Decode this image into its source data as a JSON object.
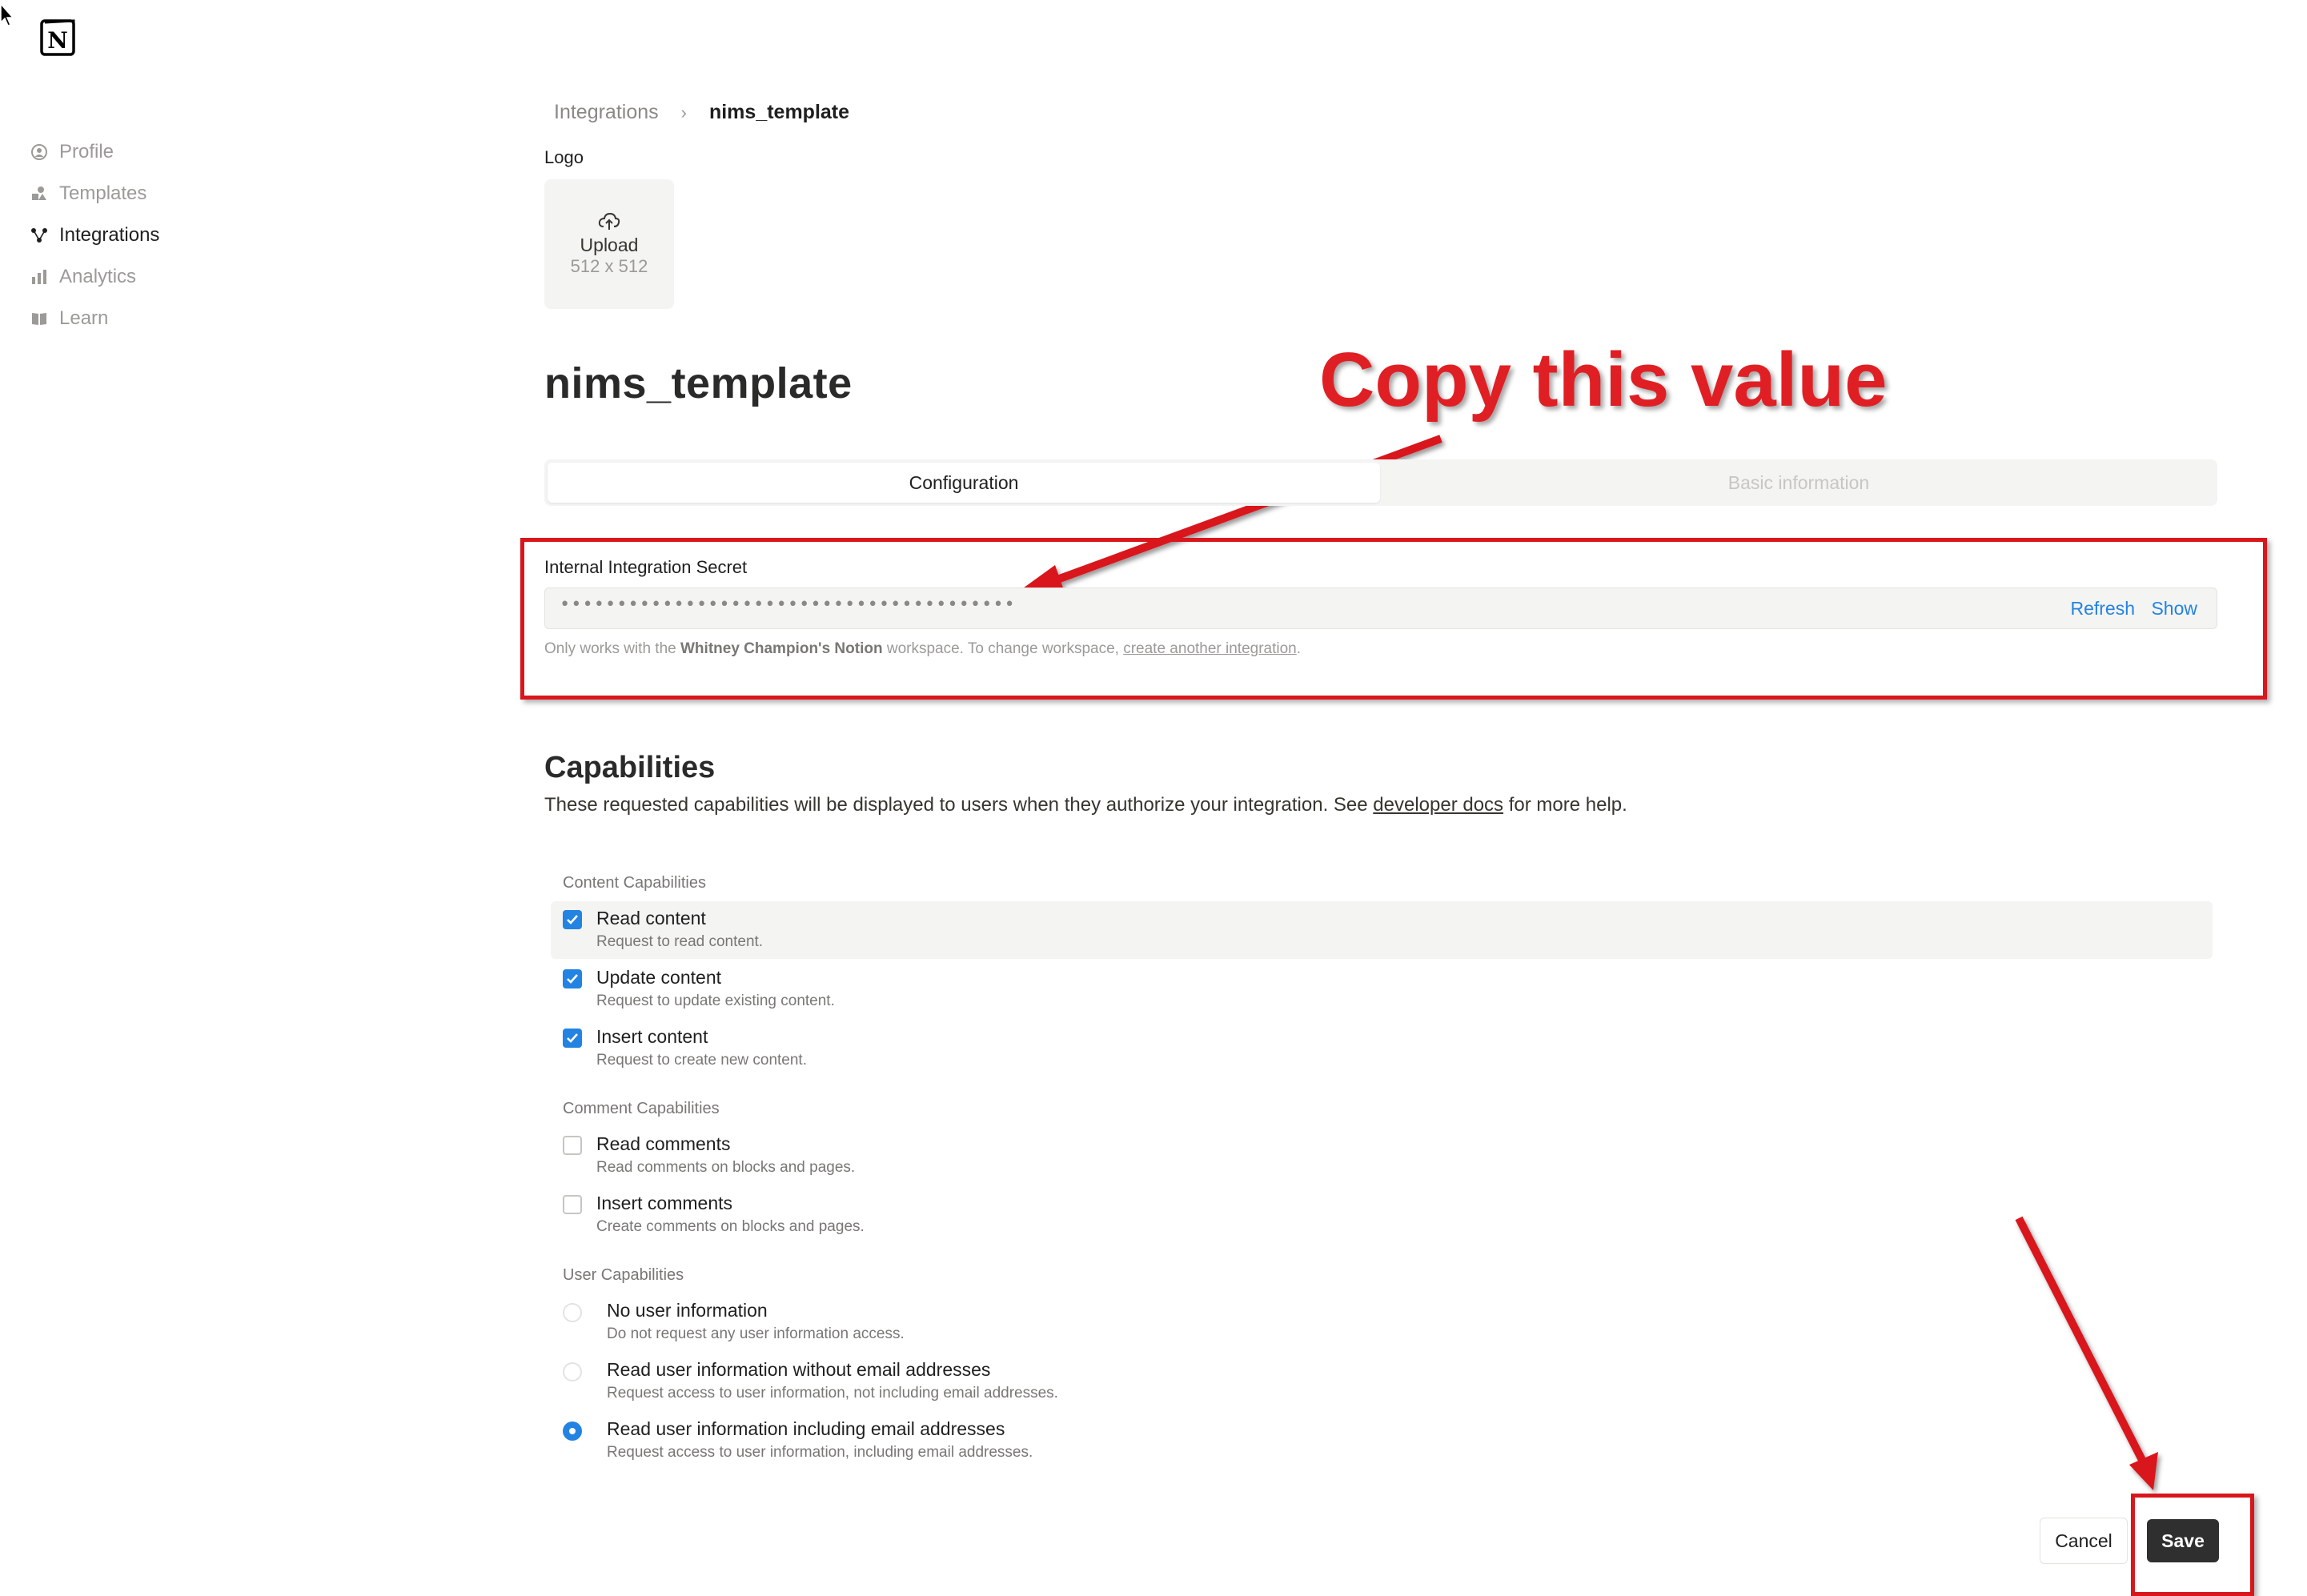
{
  "sidebar": {
    "items": [
      {
        "label": "Profile",
        "icon": "profile-icon",
        "active": false
      },
      {
        "label": "Templates",
        "icon": "templates-icon",
        "active": false
      },
      {
        "label": "Integrations",
        "icon": "integrations-icon",
        "active": true
      },
      {
        "label": "Analytics",
        "icon": "analytics-icon",
        "active": false
      },
      {
        "label": "Learn",
        "icon": "book-icon",
        "active": false
      }
    ]
  },
  "breadcrumb": {
    "parent": "Integrations",
    "separator": "›",
    "current": "nims_template"
  },
  "logo_section": {
    "label": "Logo",
    "upload_label": "Upload",
    "size_hint": "512 x 512"
  },
  "page_title": "nims_template",
  "annotation": {
    "callout": "Copy this value",
    "color": "#e01f24"
  },
  "tabs": [
    {
      "label": "Configuration",
      "active": true
    },
    {
      "label": "Basic information",
      "active": false
    }
  ],
  "secret": {
    "label": "Internal Integration Secret",
    "masked_value": "••••••••••••••••••••••••••••••••••••••••",
    "refresh_label": "Refresh",
    "show_label": "Show",
    "note_prefix": "Only works with the ",
    "note_workspace": "Whitney Champion's Notion",
    "note_middle": " workspace. To change workspace, ",
    "note_link": "create another integration",
    "note_suffix": "."
  },
  "capabilities": {
    "title": "Capabilities",
    "desc_prefix": "These requested capabilities will be displayed to users when they authorize your integration. See ",
    "desc_link": "developer docs",
    "desc_suffix": " for more help.",
    "content_label": "Content Capabilities",
    "content": [
      {
        "title": "Read content",
        "sub": "Request to read content.",
        "checked": true
      },
      {
        "title": "Update content",
        "sub": "Request to update existing content.",
        "checked": true
      },
      {
        "title": "Insert content",
        "sub": "Request to create new content.",
        "checked": true
      }
    ],
    "comment_label": "Comment Capabilities",
    "comment": [
      {
        "title": "Read comments",
        "sub": "Read comments on blocks and pages.",
        "checked": false
      },
      {
        "title": "Insert comments",
        "sub": "Create comments on blocks and pages.",
        "checked": false
      }
    ],
    "user_label": "User Capabilities",
    "user": [
      {
        "title": "No user information",
        "sub": "Do not request any user information access.",
        "selected": false
      },
      {
        "title": "Read user information without email addresses",
        "sub": "Request access to user information, not including email addresses.",
        "selected": false
      },
      {
        "title": "Read user information including email addresses",
        "sub": "Request access to user information, including email addresses.",
        "selected": true
      }
    ]
  },
  "actions": {
    "cancel_label": "Cancel",
    "save_label": "Save"
  },
  "colors": {
    "accent": "#2383e2",
    "annotation_red": "#d9161c",
    "save_bg": "#2f2f2f"
  }
}
